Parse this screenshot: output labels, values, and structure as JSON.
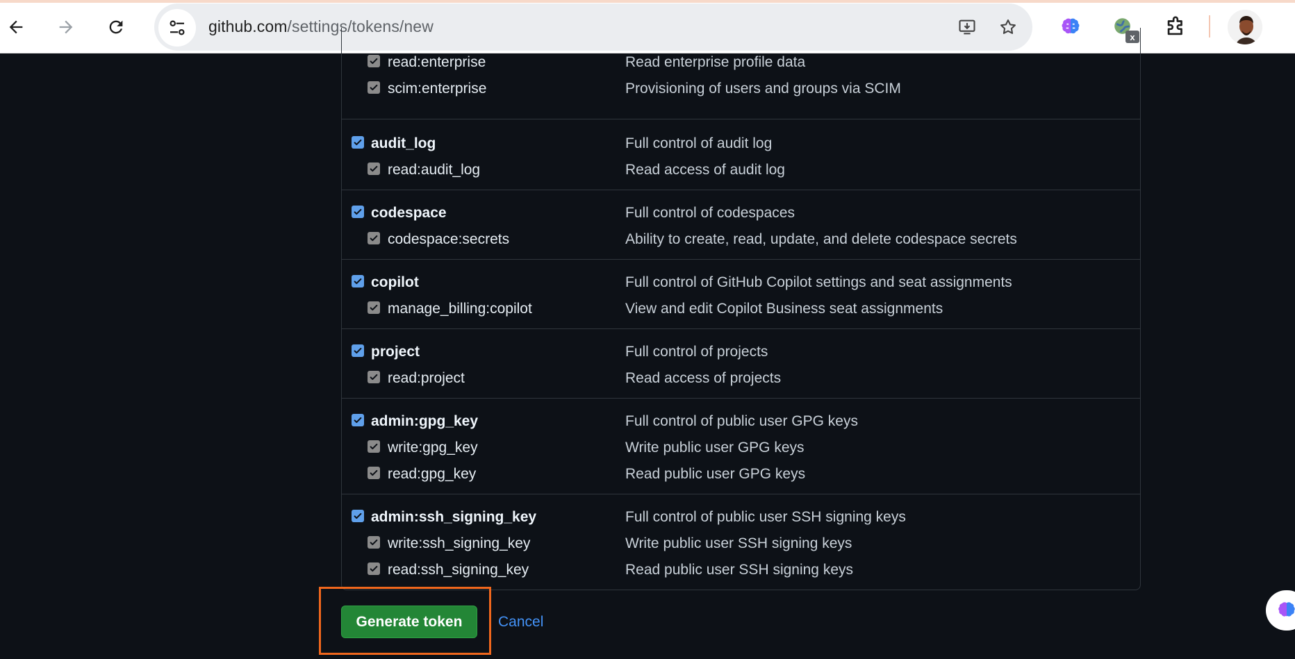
{
  "browser": {
    "url_host": "github.com",
    "url_path": "/settings/tokens/new",
    "extension_badge": "x"
  },
  "scope_groups": [
    {
      "parent": null,
      "children": [
        {
          "name": "read:enterprise",
          "description": "Read enterprise profile data",
          "checked": true
        },
        {
          "name": "scim:enterprise",
          "description": "Provisioning of users and groups via SCIM",
          "checked": true
        }
      ]
    },
    {
      "parent": {
        "name": "audit_log",
        "description": "Full control of audit log",
        "checked": true
      },
      "children": [
        {
          "name": "read:audit_log",
          "description": "Read access of audit log",
          "checked": true
        }
      ]
    },
    {
      "parent": {
        "name": "codespace",
        "description": "Full control of codespaces",
        "checked": true
      },
      "children": [
        {
          "name": "codespace:secrets",
          "description": "Ability to create, read, update, and delete codespace secrets",
          "checked": true
        }
      ]
    },
    {
      "parent": {
        "name": "copilot",
        "description": "Full control of GitHub Copilot settings and seat assignments",
        "checked": true
      },
      "children": [
        {
          "name": "manage_billing:copilot",
          "description": "View and edit Copilot Business seat assignments",
          "checked": true
        }
      ]
    },
    {
      "parent": {
        "name": "project",
        "description": "Full control of projects",
        "checked": true
      },
      "children": [
        {
          "name": "read:project",
          "description": "Read access of projects",
          "checked": true
        }
      ]
    },
    {
      "parent": {
        "name": "admin:gpg_key",
        "description": "Full control of public user GPG keys",
        "checked": true
      },
      "children": [
        {
          "name": "write:gpg_key",
          "description": "Write public user GPG keys",
          "checked": true
        },
        {
          "name": "read:gpg_key",
          "description": "Read public user GPG keys",
          "checked": true
        }
      ]
    },
    {
      "parent": {
        "name": "admin:ssh_signing_key",
        "description": "Full control of public user SSH signing keys",
        "checked": true
      },
      "children": [
        {
          "name": "write:ssh_signing_key",
          "description": "Write public user SSH signing keys",
          "checked": true
        },
        {
          "name": "read:ssh_signing_key",
          "description": "Read public user SSH signing keys",
          "checked": true
        }
      ]
    }
  ],
  "actions": {
    "generate_label": "Generate token",
    "cancel_label": "Cancel"
  },
  "colors": {
    "page_bg": "#0d1117",
    "primary_button": "#238636",
    "link": "#4493f8",
    "highlight": "#f0671d",
    "checkbox_checked": "#5fa0eb"
  }
}
